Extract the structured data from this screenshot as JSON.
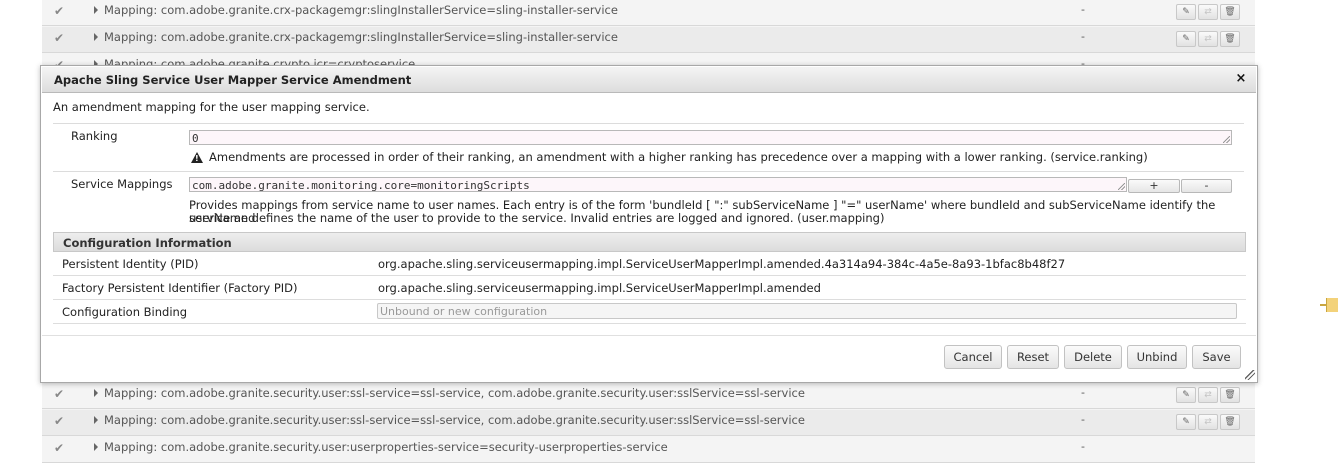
{
  "background_rows": [
    {
      "text": "Mapping: com.adobe.granite.crx-packagemgr:slingInstallerService=sling-installer-service",
      "value": "-"
    },
    {
      "text": "Mapping: com.adobe.granite.crx-packagemgr:slingInstallerService=sling-installer-service",
      "value": "-"
    },
    {
      "text": "Mapping: com.adobe.granite.crypto.jcr=cryptoservice",
      "value": "-"
    },
    {
      "text": "Mapping: com.adobe.granite.security.user:ssl-service=ssl-service, com.adobe.granite.security.user:sslService=ssl-service",
      "value": "-"
    },
    {
      "text": "Mapping: com.adobe.granite.security.user:ssl-service=ssl-service, com.adobe.granite.security.user:sslService=ssl-service",
      "value": "-"
    },
    {
      "text": "Mapping: com.adobe.granite.security.user:userproperties-service=security-userproperties-service",
      "value": "-"
    }
  ],
  "row_icons": {
    "check": "check-icon",
    "edit": "edit-icon",
    "unbind": "unbind-icon",
    "delete": "trash-icon"
  },
  "dialog": {
    "title": "Apache Sling Service User Mapper Service Amendment",
    "close_icon": "×",
    "description": "An amendment mapping for the user mapping service.",
    "ranking": {
      "label": "Ranking",
      "value": "0",
      "hint": "Amendments are processed in order of their ranking, an amendment with a higher ranking has precedence over a mapping with a lower ranking. (service.ranking)"
    },
    "service_mappings": {
      "label": "Service Mappings",
      "value": "com.adobe.granite.monitoring.core=monitoringScripts",
      "add_label": "+",
      "remove_label": "-",
      "hint_line1": "Provides mappings from service name to user names. Each entry is of the form 'bundleId [ \":\" subServiceName ] \"=\" userName' where bundleId and subServiceName identify the service and",
      "hint_line2": "userName defines the name of the user to provide to the service. Invalid entries are logged and ignored. (user.mapping)"
    },
    "config_info": {
      "heading": "Configuration Information",
      "pid_label": "Persistent Identity (PID)",
      "pid_value": "org.apache.sling.serviceusermapping.impl.ServiceUserMapperImpl.amended.4a314a94-384c-4a5e-8a93-1bfac8b48f27",
      "factory_pid_label": "Factory Persistent Identifier (Factory PID)",
      "factory_pid_value": "org.apache.sling.serviceusermapping.impl.ServiceUserMapperImpl.amended",
      "binding_label": "Configuration Binding",
      "binding_placeholder": "Unbound or new configuration"
    },
    "buttons": {
      "cancel": "Cancel",
      "reset": "Reset",
      "delete": "Delete",
      "unbind": "Unbind",
      "save": "Save"
    }
  },
  "colors": {
    "accent_scroll_marker": "#f3d27a",
    "dialog_title_bg": "#dddddd",
    "input_bg": "#fdf6fa"
  }
}
